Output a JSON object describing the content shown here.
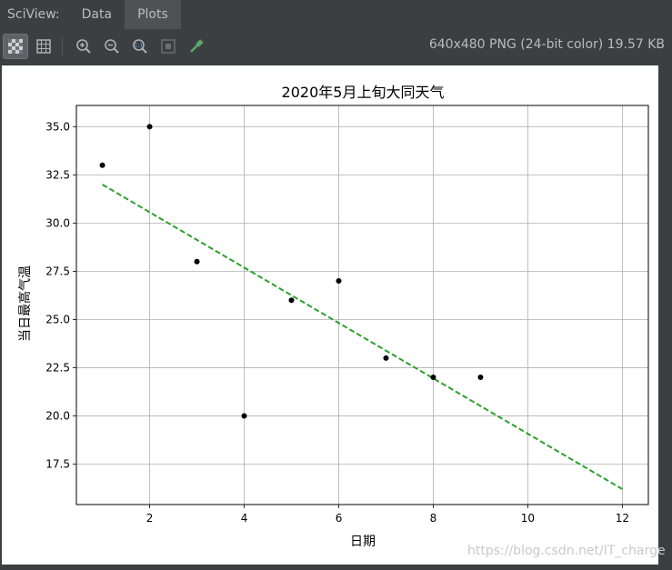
{
  "topbar": {
    "label": "SciView:",
    "tabs": [
      {
        "label": "Data",
        "active": false
      },
      {
        "label": "Plots",
        "active": true
      }
    ]
  },
  "toolbar": {
    "icons": [
      "checkerboard-icon",
      "grid-icon",
      "zoom-in-icon",
      "zoom-out-icon",
      "zoom-actual-icon",
      "fit-icon",
      "color-picker-icon"
    ],
    "image_info": "640x480 PNG (24-bit color) 19.57 KB"
  },
  "watermark": "https://blog.csdn.net/IT_charge",
  "chart_data": {
    "type": "scatter",
    "title": "2020年5月上旬大同天气",
    "xlabel": "日期",
    "ylabel": "当日最高气温",
    "xlim": [
      0.45,
      12.55
    ],
    "ylim": [
      15.4,
      36.1
    ],
    "xticks": [
      "2",
      "4",
      "6",
      "8",
      "10",
      "12"
    ],
    "yticks": [
      "17.5",
      "20.0",
      "22.5",
      "25.0",
      "27.5",
      "30.0",
      "32.5",
      "35.0"
    ],
    "grid": true,
    "points": {
      "x": [
        1,
        2,
        3,
        4,
        5,
        6,
        7,
        8,
        9
      ],
      "y": [
        33,
        35,
        28,
        20,
        26,
        27,
        23,
        22,
        22
      ],
      "color": "#000000"
    },
    "trend": {
      "x": [
        1,
        12
      ],
      "y": [
        32.0,
        16.2
      ],
      "color": "#2ca02c",
      "style": "dashed"
    }
  }
}
